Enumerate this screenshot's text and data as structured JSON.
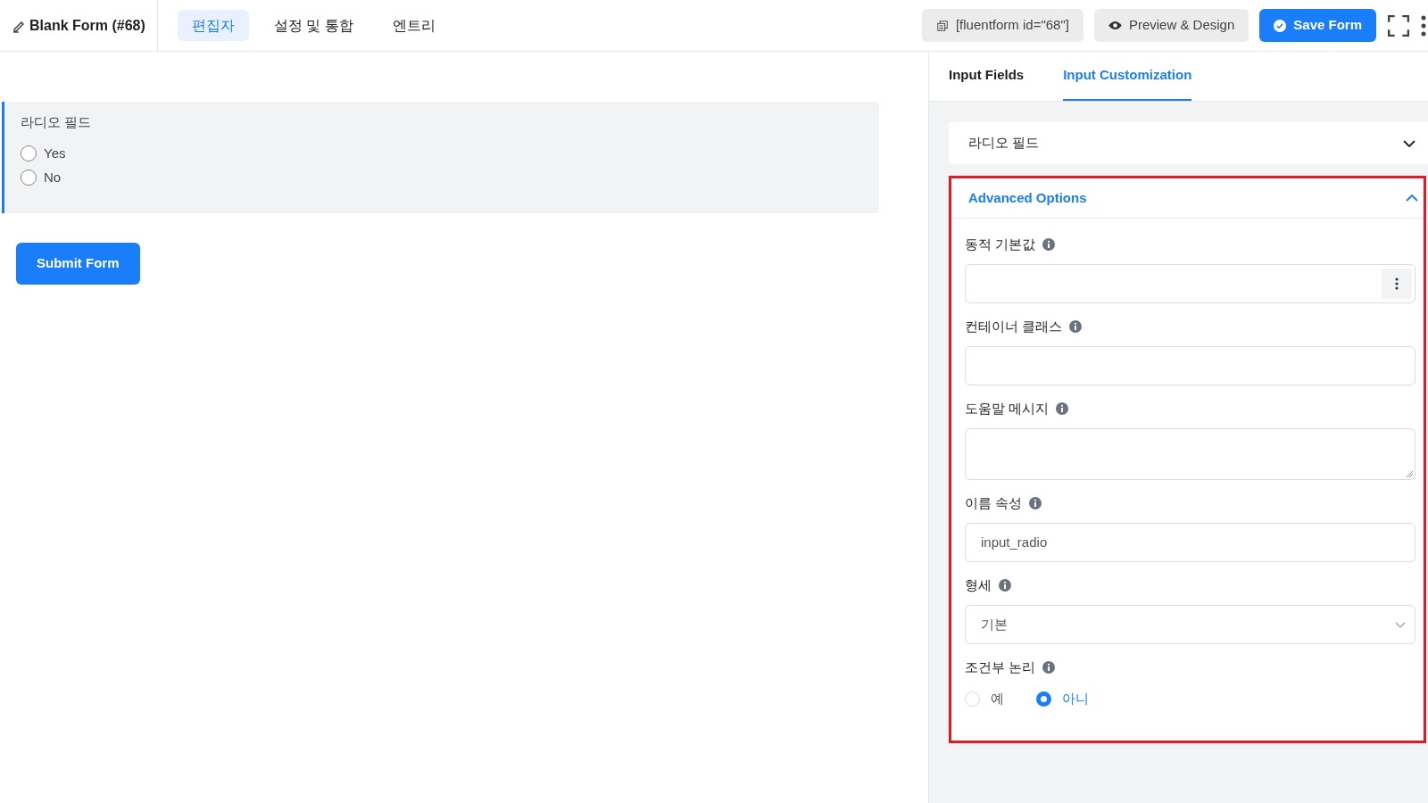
{
  "header": {
    "title": "Blank Form (#68)",
    "tabs": [
      {
        "label": "편집자",
        "selected": true
      },
      {
        "label": "설정 및 통합",
        "selected": false
      },
      {
        "label": "엔트리",
        "selected": false
      }
    ],
    "shortcode": "[fluentform id=\"68\"]",
    "preview_button": "Preview & Design",
    "save_button": "Save Form"
  },
  "canvas": {
    "field": {
      "label": "라디오 필드",
      "options": [
        {
          "label": "Yes",
          "selected": false
        },
        {
          "label": "No",
          "selected": false
        }
      ]
    },
    "submit_button": "Submit Form"
  },
  "panel": {
    "tabs": [
      {
        "label": "Input Fields",
        "selected": false
      },
      {
        "label": "Input Customization",
        "selected": true
      }
    ],
    "basic_section": {
      "title": "라디오 필드",
      "expanded": false
    },
    "advanced_section": {
      "title": "Advanced Options",
      "expanded": true,
      "highlighted": true,
      "fields": [
        {
          "kind": "menu-input",
          "label": "동적 기본값"
        },
        {
          "kind": "input",
          "label": "컨테이너 클래스"
        },
        {
          "kind": "textarea",
          "label": "도움말 메시지"
        },
        {
          "kind": "input",
          "label": "이름 속성",
          "value": "input_radio"
        },
        {
          "kind": "select",
          "label": "형세",
          "value": "기본"
        },
        {
          "kind": "radio",
          "label": "조건부 논리",
          "options": [
            {
              "label": "예",
              "selected": false
            },
            {
              "label": "아니",
              "selected": true
            }
          ]
        }
      ]
    }
  }
}
